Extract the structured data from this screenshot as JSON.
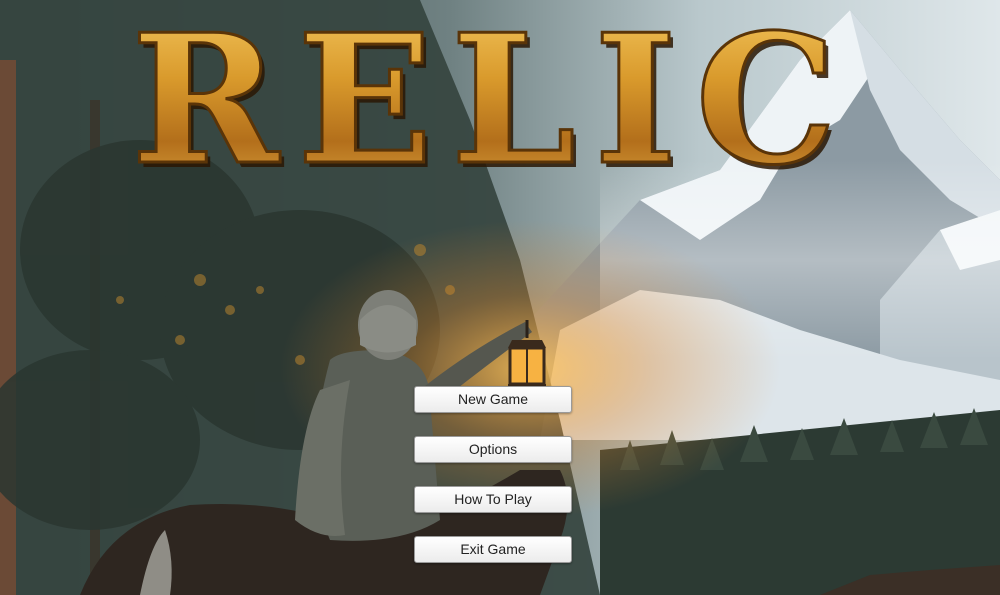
{
  "game_title": "RELIC",
  "menu": {
    "buttons": [
      {
        "label": "New Game"
      },
      {
        "label": "Options"
      },
      {
        "label": "How To Play"
      },
      {
        "label": "Exit Game"
      }
    ]
  },
  "colors": {
    "title_gold": "#d9a33a",
    "title_shadow": "#3a2006",
    "lantern_glow": "#f7a431",
    "snow": "#e8eef2",
    "forest": "#2f3b33"
  }
}
